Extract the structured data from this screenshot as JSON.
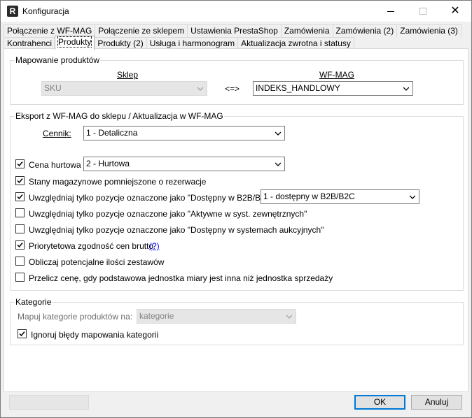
{
  "window": {
    "title": "Konfiguracja",
    "app_icon_letter": "R"
  },
  "tabs_row1": [
    "Połączenie z WF-MAG",
    "Połączenie ze sklepem",
    "Ustawienia PrestaShop",
    "Zamówienia",
    "Zamówienia (2)",
    "Zamówienia (3)"
  ],
  "tabs_row2": [
    "Kontrahenci",
    "Produkty",
    "Produkty (2)",
    "Usługa i harmonogram",
    "Aktualizacja zwrotna i statusy"
  ],
  "active_tab": "Produkty",
  "mapping": {
    "legend": "Mapowanie produktów",
    "shop_header": "Sklep",
    "wfmag_header": "WF-MAG",
    "shop_value": "SKU",
    "arrow_text": "<=>",
    "wfmag_value": "INDEKS_HANDLOWY"
  },
  "export": {
    "legend": "Eksport z WF-MAG do sklepu / Aktualizacja w WF-MAG",
    "pricelist_label": "Cennik:",
    "pricelist_value": "1 - Detaliczna",
    "wholesale_label": "Cena hurtowa",
    "wholesale_value": "2 - Hurtowa",
    "options": [
      {
        "label": "Stany magazynowe pomniejszone o rezerwacje",
        "checked": true
      },
      {
        "label": "Uwzględniaj tylko pozycje oznaczone jako \"Dostępny w B2B/B2C\":",
        "checked": true
      },
      {
        "label": "Uwzględniaj tylko pozycje oznaczone jako \"Aktywne w syst. zewnętrznych\"",
        "checked": false
      },
      {
        "label": "Uwzględniaj tylko pozycje oznaczone jako \"Dostępny w systemach aukcyjnych\"",
        "checked": false
      },
      {
        "label": "Priorytetowa zgodność cen brutto",
        "checked": true
      },
      {
        "label": "Obliczaj potencjalne ilości zestawów",
        "checked": false
      },
      {
        "label": "Przelicz cenę, gdy podstawowa jednostka miary jest inna niż jednostka sprzedaży",
        "checked": false
      }
    ],
    "b2b_value": "1 - dostępny w B2B/B2C",
    "help_link": "(?)"
  },
  "categories": {
    "legend": "Kategorie",
    "map_label": "Mapuj kategorie produktów na:",
    "map_value": "kategorie",
    "ignore_label": "Ignoruj błędy mapowania kategorii",
    "ignore_checked": true
  },
  "buttons": {
    "ok": "OK",
    "cancel": "Anuluj",
    "left_blank": ""
  }
}
